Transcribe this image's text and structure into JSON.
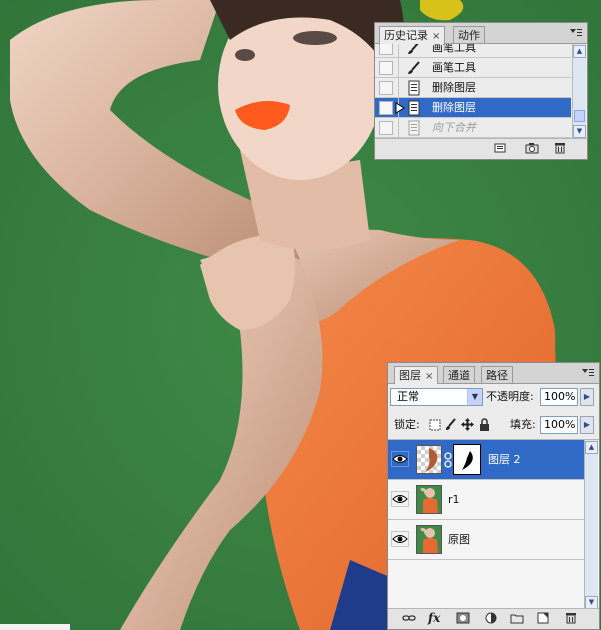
{
  "history_panel": {
    "tabs": [
      {
        "label": "历史记录",
        "close": "×"
      },
      {
        "label": "动作"
      }
    ],
    "menu_icon": "panel-menu-icon",
    "rows": [
      {
        "label": "画笔工具",
        "icon": "brush-icon",
        "state": "normal"
      },
      {
        "label": "画笔工具",
        "icon": "brush-icon",
        "state": "normal"
      },
      {
        "label": "删除图层",
        "icon": "history-state-icon",
        "state": "normal"
      },
      {
        "label": "删除图层",
        "icon": "history-state-icon",
        "state": "selected"
      },
      {
        "label": "向下合并",
        "icon": "history-state-icon",
        "state": "dimmed"
      }
    ],
    "footer_icons": [
      "new-document-icon",
      "snapshot-camera-icon",
      "trash-icon"
    ]
  },
  "layers_panel": {
    "tabs": [
      {
        "label": "图层",
        "close": "×"
      },
      {
        "label": "通道"
      },
      {
        "label": "路径"
      }
    ],
    "blend_mode": "正常",
    "opacity_label": "不透明度:",
    "opacity_value": "100%",
    "lock_label": "锁定:",
    "fill_label": "填充:",
    "fill_value": "100%",
    "layers": [
      {
        "name": "图层 2",
        "selected": true,
        "has_mask": true
      },
      {
        "name": "r1",
        "selected": false,
        "has_mask": false
      },
      {
        "name": "原图",
        "selected": false,
        "has_mask": false
      }
    ],
    "footer_icons": [
      "link-icon",
      "fx-icon",
      "mask-icon",
      "adjustment-icon",
      "folder-icon",
      "new-layer-icon",
      "trash-icon"
    ],
    "fx_label": "fx"
  },
  "colors": {
    "background_green": "#3a8244",
    "selection_blue": "#3169c6",
    "panel_bg": "#ececec"
  }
}
